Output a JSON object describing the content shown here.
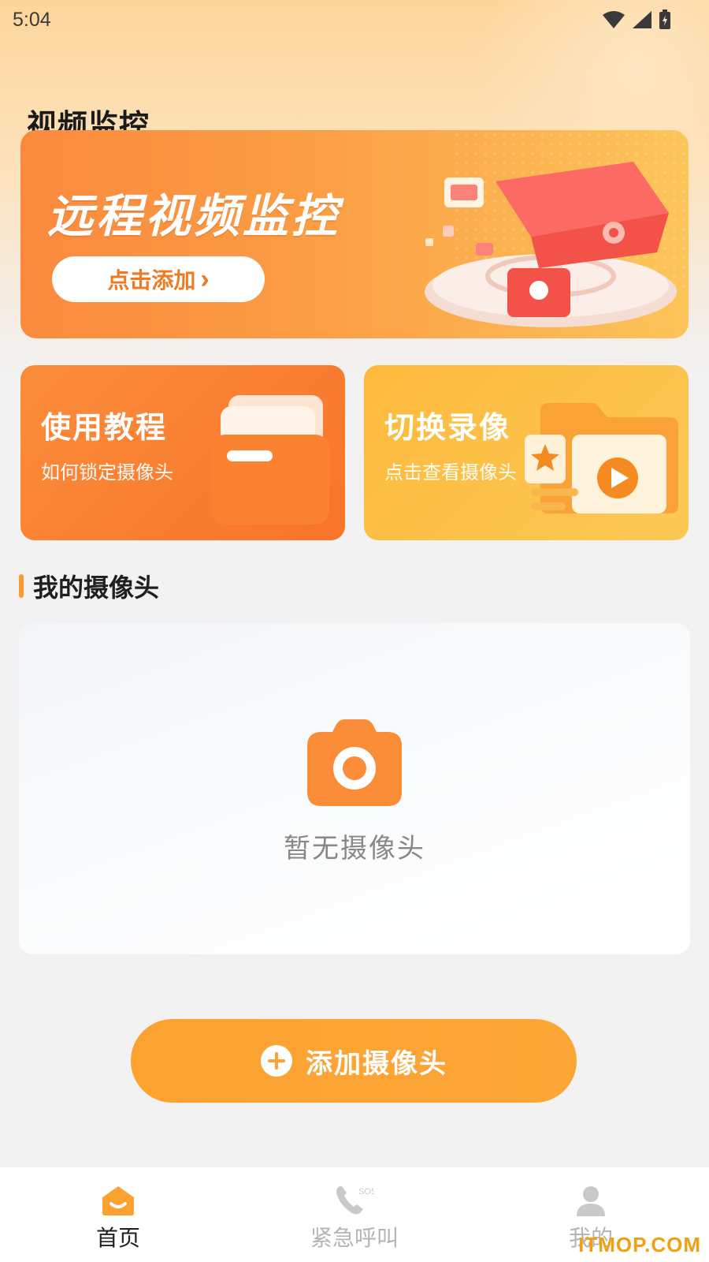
{
  "status_bar": {
    "time": "5:04"
  },
  "page": {
    "title": "视频监控"
  },
  "banner": {
    "title": "远程视频监控",
    "button_label": "点击添加",
    "button_chevron": "›"
  },
  "cards": [
    {
      "title": "使用教程",
      "subtitle": "如何锁定摄像头"
    },
    {
      "title": "切换录像",
      "subtitle": "点击查看摄像头"
    }
  ],
  "section": {
    "title": "我的摄像头"
  },
  "empty_state": {
    "text": "暂无摄像头",
    "icon": "camera-icon"
  },
  "add_button": {
    "label": "添加摄像头",
    "icon": "plus-circle-icon"
  },
  "tabbar": {
    "items": [
      {
        "label": "首页",
        "icon": "home-icon",
        "active": true
      },
      {
        "label": "紧急呼叫",
        "icon": "phone-sos-icon",
        "active": false
      },
      {
        "label": "我的",
        "icon": "user-icon",
        "active": false
      }
    ]
  },
  "watermark": "ITMOP.COM",
  "colors": {
    "accent": "#fba231",
    "active_tab": "#1f1f1f",
    "inactive_tab": "#b5b5b5"
  }
}
